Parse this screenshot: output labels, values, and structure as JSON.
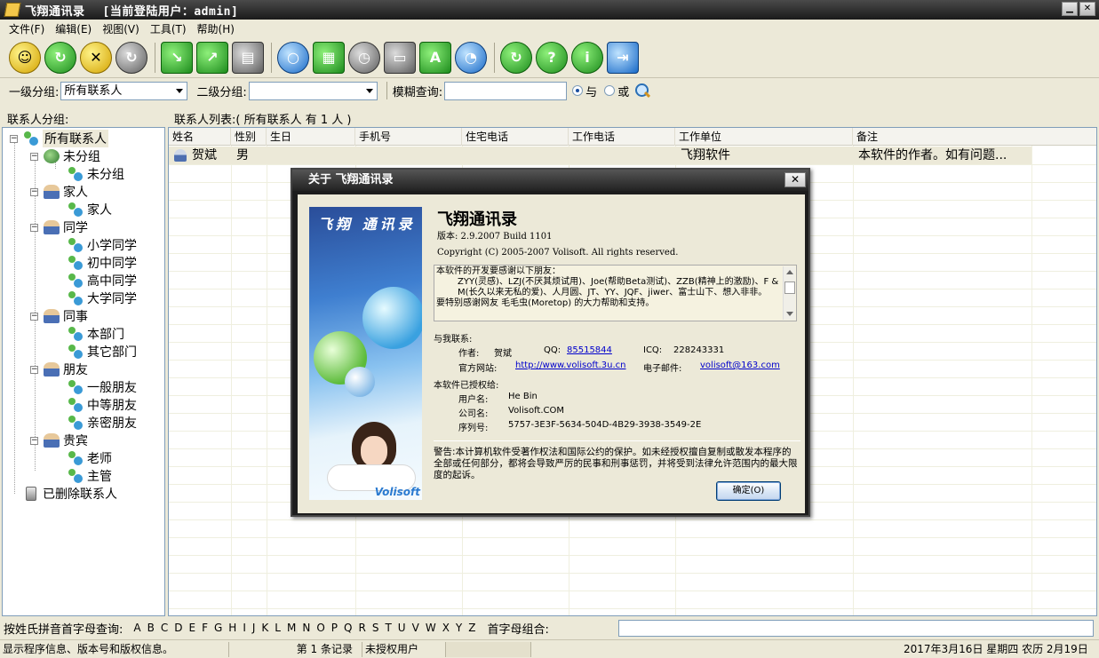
{
  "window": {
    "title": "飞翔通讯录",
    "current_user": "[当前登陆用户：admin]",
    "minimize": "▁",
    "close": "✕"
  },
  "menu": [
    "文件(F)",
    "编辑(E)",
    "视图(V)",
    "工具(T)",
    "帮助(H)"
  ],
  "toolbar_icons": [
    "smiley-icon",
    "refresh-contact-icon",
    "delete-contact-icon",
    "sync-icon",
    "import-icon",
    "export-icon",
    "print-icon",
    "search-icon",
    "calendar-icon",
    "clock-icon",
    "fax-icon",
    "book-icon",
    "chart-icon",
    "update-icon",
    "help-icon",
    "info-icon",
    "exit-icon"
  ],
  "filter": {
    "group1_label": "一级分组:",
    "group1_value": "所有联系人",
    "group2_label": "二级分组:",
    "group2_value": "",
    "fuzzy_label": "模糊查询:",
    "fuzzy_value": "",
    "and_label": "与",
    "or_label": "或"
  },
  "groups_label": "联系人分组:",
  "list_label": "联系人列表:( 所有联系人 有 1 人 )",
  "tree": [
    {
      "label": "所有联系人",
      "level": 0,
      "icon": "group-icon",
      "toggle": "−",
      "selected": true
    },
    {
      "label": "未分组",
      "level": 1,
      "icon": "group-icon",
      "toggle": "−"
    },
    {
      "label": "未分组",
      "level": 2,
      "icon": "people-icon"
    },
    {
      "label": "家人",
      "level": 1,
      "icon": "person-icon",
      "toggle": "−"
    },
    {
      "label": "家人",
      "level": 2,
      "icon": "people-icon"
    },
    {
      "label": "同学",
      "level": 1,
      "icon": "person-icon",
      "toggle": "−"
    },
    {
      "label": "小学同学",
      "level": 2,
      "icon": "people-icon"
    },
    {
      "label": "初中同学",
      "level": 2,
      "icon": "people-icon"
    },
    {
      "label": "高中同学",
      "level": 2,
      "icon": "people-icon"
    },
    {
      "label": "大学同学",
      "level": 2,
      "icon": "people-icon"
    },
    {
      "label": "同事",
      "level": 1,
      "icon": "person-icon",
      "toggle": "−"
    },
    {
      "label": "本部门",
      "level": 2,
      "icon": "people-icon"
    },
    {
      "label": "其它部门",
      "level": 2,
      "icon": "people-icon"
    },
    {
      "label": "朋友",
      "level": 1,
      "icon": "person-icon",
      "toggle": "−"
    },
    {
      "label": "一般朋友",
      "level": 2,
      "icon": "people-icon"
    },
    {
      "label": "中等朋友",
      "level": 2,
      "icon": "people-icon"
    },
    {
      "label": "亲密朋友",
      "level": 2,
      "icon": "people-icon"
    },
    {
      "label": "贵宾",
      "level": 1,
      "icon": "person-icon",
      "toggle": "−"
    },
    {
      "label": "老师",
      "level": 2,
      "icon": "people-icon"
    },
    {
      "label": "主管",
      "level": 2,
      "icon": "people-icon"
    },
    {
      "label": "已删除联系人",
      "level": 0,
      "icon": "trash-icon"
    }
  ],
  "columns": [
    "姓名",
    "性别",
    "生日",
    "手机号",
    "住宅电话",
    "工作电话",
    "工作单位",
    "备注"
  ],
  "rows": [
    {
      "name": "贺斌",
      "gender": "男",
      "birthday": "",
      "mobile": "",
      "home_phone": "",
      "work_phone": "",
      "company": "飞翔软件",
      "note": "本软件的作者。如有问题..."
    }
  ],
  "letter_bar": {
    "label": "按姓氏拼音首字母查询:",
    "letters": [
      "A",
      "B",
      "C",
      "D",
      "E",
      "F",
      "G",
      "H",
      "I",
      "J",
      "K",
      "L",
      "M",
      "N",
      "O",
      "P",
      "Q",
      "R",
      "S",
      "T",
      "U",
      "V",
      "W",
      "X",
      "Y",
      "Z"
    ],
    "combo_label": "首字母组合:"
  },
  "status": {
    "message": "显示程序信息、版本号和版权信息。",
    "records": "第 1 条记录",
    "license": "未授权用户",
    "date": "2017年3月16日 星期四 农历 2月19日"
  },
  "about": {
    "title": "关于 飞翔通讯录",
    "close": "✕",
    "banner_title": "飞翔 通讯录",
    "banner_brand": "Volisoft",
    "app_name": "飞翔通讯录",
    "version": "版本: 2.9.2007 Build 1101",
    "copyright": "Copyright (C) 2005-2007 Volisoft. All rights reserved.",
    "thanks": [
      "本软件的开发要感谢以下朋友：",
      "ZYY(灵感)、LZJ(不厌其烦试用)、Joe(帮助Beta测试)、ZZB(精神上的激励)、F & M(长久以来无私的爱)、人月圆、JT、YY、JQF、jiwer、富士山下、想入非非。",
      "要特别感谢网友 毛毛虫(Moretop) 的大力帮助和支持。"
    ],
    "contact_label": "与我联系:",
    "author_label": "作者:",
    "author": "贺斌",
    "qq_label": "QQ:",
    "qq": "85515844",
    "icq_label": "ICQ:",
    "icq": "228243331",
    "site_label": "官方网站:",
    "site": "http://www.volisoft.3u.cn",
    "email_label": "电子邮件:",
    "email": "volisoft@163.com",
    "licensed_label": "本软件已授权给:",
    "username_label": "用户名:",
    "username": "He Bin",
    "company_label": "公司名:",
    "company": "Volisoft.COM",
    "serial_label": "序列号:",
    "serial": "5757-3E3F-5634-504D-4B29-3938-3549-2E",
    "warning": "警告:本计算机软件受著作权法和国际公约的保护。如未经授权擅自复制或散发本程序的全部或任何部分，都将会导致严厉的民事和刑事惩罚，并将受到法律允许范围内的最大限度的起诉。",
    "ok": "确定(O)"
  }
}
